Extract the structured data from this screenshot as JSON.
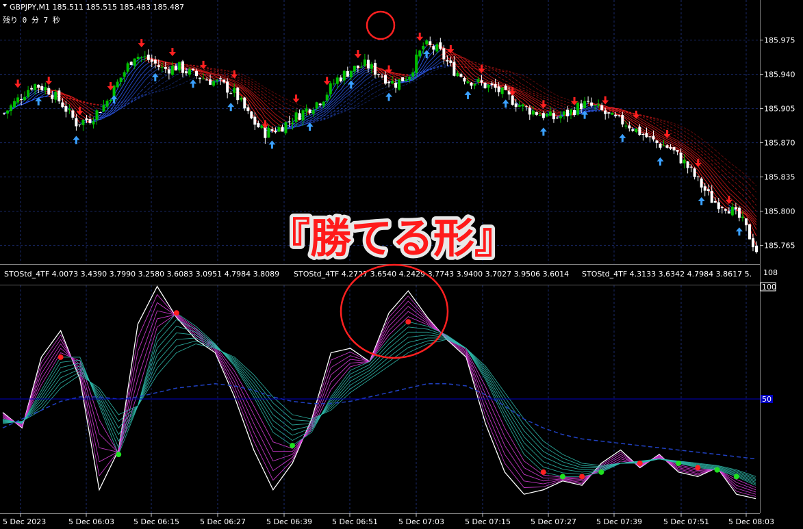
{
  "window": {
    "symbol_line": "GBPJPY,M1  185.511 185.515 185.483 185.487",
    "countdown": "残り 0 分 7 秒",
    "overlay_title": "『勝てる形』"
  },
  "indicator": {
    "label_1": "STOStd_4TF 4.0073 3.4390 3.7990 3.2580 3.6083 3.0951 4.7984 3.8089",
    "label_2": "STOStd_4TF 4.2727 3.6540 4.2429 3.7743 3.9400 3.7027 3.9506 3.6014",
    "label_3": "STOStd_4TF 4.3133 3.6342 4.7984 3.8617 5.",
    "scale_max": "108",
    "level_100": "100",
    "level_50": "50"
  },
  "colors": {
    "background": "#000000",
    "bull_candle": "#00c000",
    "bear_candle": "#ffffff",
    "sell_arrow": "#ff2020",
    "buy_arrow": "#3aa0ff",
    "ribbon_bear": "#ff2020",
    "ribbon_bull": "#3060ff",
    "stoch_main": "#ffffff",
    "stoch_magenta": "#e040e0",
    "stoch_teal": "#30c0b0",
    "signal_red": "#ff2020",
    "signal_green": "#20e020",
    "grid": "#1a2a6a",
    "highlight_circle": "#ff2020"
  },
  "chart_data": [
    {
      "type": "candlestick",
      "title": "GBPJPY,M1",
      "ylim": [
        185.75,
        185.995
      ],
      "y_ticks": [
        "185.975",
        "185.940",
        "185.905",
        "185.870",
        "185.835",
        "185.800",
        "185.765"
      ],
      "x_ticks": [
        "5 Dec 2023",
        "5 Dec 06:03",
        "5 Dec 06:15",
        "5 Dec 06:27",
        "5 Dec 06:39",
        "5 Dec 06:51",
        "5 Dec 07:03",
        "5 Dec 07:15",
        "5 Dec 07:27",
        "5 Dec 07:39",
        "5 Dec 07:51",
        "5 Dec 08:03"
      ],
      "close_path": [
        185.9,
        185.915,
        185.93,
        185.925,
        185.91,
        185.89,
        185.895,
        185.91,
        185.935,
        185.96,
        185.955,
        185.945,
        185.948,
        185.94,
        185.935,
        185.93,
        185.92,
        185.895,
        185.88,
        185.885,
        185.895,
        185.905,
        185.915,
        185.935,
        185.945,
        185.95,
        185.94,
        185.93,
        185.94,
        185.97,
        185.965,
        185.945,
        185.935,
        185.93,
        185.925,
        185.915,
        185.905,
        185.9,
        185.895,
        185.9,
        185.91,
        185.905,
        185.895,
        185.89,
        185.88,
        185.87,
        185.865,
        185.85,
        185.83,
        185.81,
        185.805,
        185.79,
        185.76
      ],
      "sell_arrow_count": 24,
      "buy_arrow_count": 19
    },
    {
      "type": "line",
      "title": "STOStd_4TF",
      "ylim": [
        0,
        108
      ],
      "y_ticks": [
        "100",
        "50"
      ],
      "x_ticks": [
        "5 Dec 2023",
        "5 Dec 06:03",
        "5 Dec 06:15",
        "5 Dec 06:27",
        "5 Dec 06:39",
        "5 Dec 06:51",
        "5 Dec 07:03",
        "5 Dec 07:15",
        "5 Dec 07:27",
        "5 Dec 07:39",
        "5 Dec 07:51",
        "5 Dec 08:03"
      ],
      "series": [
        {
          "values": [
            45,
            38,
            70,
            82,
            60,
            10,
            28,
            85,
            102,
            88,
            78,
            72,
            52,
            28,
            10,
            22,
            42,
            72,
            74,
            68,
            90,
            100,
            88,
            78,
            70,
            40,
            18,
            8,
            10,
            14,
            12,
            22,
            28,
            20,
            26,
            18,
            16,
            20,
            8,
            6
          ]
        },
        {
          "values": [
            42,
            40,
            55,
            70,
            70,
            48,
            26,
            48,
            80,
            90,
            84,
            76,
            66,
            52,
            36,
            30,
            36,
            52,
            64,
            68,
            78,
            86,
            84,
            80,
            74,
            60,
            42,
            26,
            18,
            16,
            16,
            18,
            22,
            22,
            24,
            22,
            20,
            19,
            16,
            12
          ]
        },
        {
          "values": [
            40,
            41,
            46,
            56,
            62,
            56,
            44,
            48,
            62,
            72,
            76,
            74,
            70,
            62,
            52,
            44,
            42,
            46,
            54,
            60,
            66,
            72,
            76,
            78,
            74,
            66,
            54,
            42,
            32,
            26,
            22,
            21,
            22,
            23,
            24,
            23,
            22,
            21,
            19,
            16
          ]
        },
        {
          "values": [
            38,
            42,
            46,
            50,
            52,
            52,
            51,
            52,
            54,
            56,
            57,
            58,
            57,
            55,
            52,
            50,
            49,
            49,
            50,
            52,
            54,
            56,
            58,
            58,
            57,
            53,
            48,
            42,
            38,
            35,
            33,
            32,
            31,
            30,
            29,
            28,
            27,
            26,
            25,
            24
          ]
        }
      ],
      "red_signal_count": 7,
      "green_signal_count": 7
    }
  ]
}
